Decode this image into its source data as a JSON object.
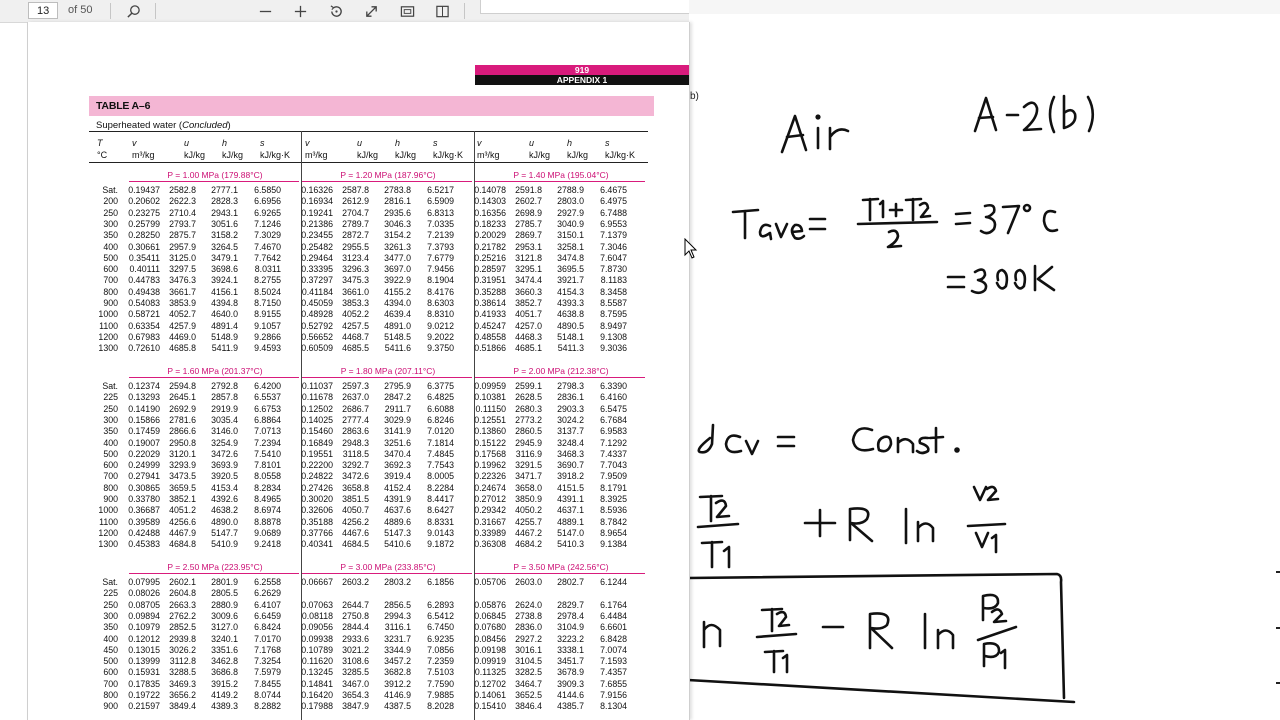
{
  "toolbar": {
    "page_current": "13",
    "page_total": "of 50",
    "icons": [
      "search-icon",
      "zoom-out-icon",
      "zoom-in-icon",
      "rotate-icon",
      "fit-width-icon",
      "fullscreen-icon",
      "two-page-icon"
    ]
  },
  "page": {
    "page_number": "919",
    "appendix": "APPENDIX 1",
    "table_title": "TABLE A–6",
    "subtitle_prefix": "Superheated water (",
    "subtitle_italic": "Concluded",
    "subtitle_suffix": ")",
    "col_T": "T",
    "col_T_unit": "°C",
    "group_headers": [
      {
        "v": "v",
        "u": "u",
        "h": "h",
        "s": "s",
        "v_unit": "m³/kg",
        "u_unit": "kJ/kg",
        "h_unit": "kJ/kg",
        "s_unit": "kJ/kg·K"
      },
      {
        "v": "v",
        "u": "u",
        "h": "h",
        "s": "s",
        "v_unit": "m³/kg",
        "u_unit": "kJ/kg",
        "h_unit": "kJ/kg",
        "s_unit": "kJ/kg·K"
      },
      {
        "v": "v",
        "u": "u",
        "h": "h",
        "s": "s",
        "v_unit": "m³/kg",
        "u_unit": "kJ/kg",
        "h_unit": "kJ/kg",
        "s_unit": "kJ/kg·K"
      }
    ],
    "sections": [
      {
        "pressures": [
          "P = 1.00 MPa (179.88°C)",
          "P = 1.20 MPa (187.96°C)",
          "P = 1.40 MPa (195.04°C)"
        ],
        "rows": [
          [
            "Sat.",
            "0.19437",
            "2582.8",
            "2777.1",
            "6.5850",
            "0.16326",
            "2587.8",
            "2783.8",
            "6.5217",
            "0.14078",
            "2591.8",
            "2788.9",
            "6.4675"
          ],
          [
            "200",
            "0.20602",
            "2622.3",
            "2828.3",
            "6.6956",
            "0.16934",
            "2612.9",
            "2816.1",
            "6.5909",
            "0.14303",
            "2602.7",
            "2803.0",
            "6.4975"
          ],
          [
            "250",
            "0.23275",
            "2710.4",
            "2943.1",
            "6.9265",
            "0.19241",
            "2704.7",
            "2935.6",
            "6.8313",
            "0.16356",
            "2698.9",
            "2927.9",
            "6.7488"
          ],
          [
            "300",
            "0.25799",
            "2793.7",
            "3051.6",
            "7.1246",
            "0.21386",
            "2789.7",
            "3046.3",
            "7.0335",
            "0.18233",
            "2785.7",
            "3040.9",
            "6.9553"
          ],
          [
            "350",
            "0.28250",
            "2875.7",
            "3158.2",
            "7.3029",
            "0.23455",
            "2872.7",
            "3154.2",
            "7.2139",
            "0.20029",
            "2869.7",
            "3150.1",
            "7.1379"
          ],
          [
            "400",
            "0.30661",
            "2957.9",
            "3264.5",
            "7.4670",
            "0.25482",
            "2955.5",
            "3261.3",
            "7.3793",
            "0.21782",
            "2953.1",
            "3258.1",
            "7.3046"
          ],
          [
            "500",
            "0.35411",
            "3125.0",
            "3479.1",
            "7.7642",
            "0.29464",
            "3123.4",
            "3477.0",
            "7.6779",
            "0.25216",
            "3121.8",
            "3474.8",
            "7.6047"
          ],
          [
            "600",
            "0.40111",
            "3297.5",
            "3698.6",
            "8.0311",
            "0.33395",
            "3296.3",
            "3697.0",
            "7.9456",
            "0.28597",
            "3295.1",
            "3695.5",
            "7.8730"
          ],
          [
            "700",
            "0.44783",
            "3476.3",
            "3924.1",
            "8.2755",
            "0.37297",
            "3475.3",
            "3922.9",
            "8.1904",
            "0.31951",
            "3474.4",
            "3921.7",
            "8.1183"
          ],
          [
            "800",
            "0.49438",
            "3661.7",
            "4156.1",
            "8.5024",
            "0.41184",
            "3661.0",
            "4155.2",
            "8.4176",
            "0.35288",
            "3660.3",
            "4154.3",
            "8.3458"
          ],
          [
            "900",
            "0.54083",
            "3853.9",
            "4394.8",
            "8.7150",
            "0.45059",
            "3853.3",
            "4394.0",
            "8.6303",
            "0.38614",
            "3852.7",
            "4393.3",
            "8.5587"
          ],
          [
            "1000",
            "0.58721",
            "4052.7",
            "4640.0",
            "8.9155",
            "0.48928",
            "4052.2",
            "4639.4",
            "8.8310",
            "0.41933",
            "4051.7",
            "4638.8",
            "8.7595"
          ],
          [
            "1100",
            "0.63354",
            "4257.9",
            "4891.4",
            "9.1057",
            "0.52792",
            "4257.5",
            "4891.0",
            "9.0212",
            "0.45247",
            "4257.0",
            "4890.5",
            "8.9497"
          ],
          [
            "1200",
            "0.67983",
            "4469.0",
            "5148.9",
            "9.2866",
            "0.56652",
            "4468.7",
            "5148.5",
            "9.2022",
            "0.48558",
            "4468.3",
            "5148.1",
            "9.1308"
          ],
          [
            "1300",
            "0.72610",
            "4685.8",
            "5411.9",
            "9.4593",
            "0.60509",
            "4685.5",
            "5411.6",
            "9.3750",
            "0.51866",
            "4685.1",
            "5411.3",
            "9.3036"
          ]
        ]
      },
      {
        "pressures": [
          "P = 1.60 MPa (201.37°C)",
          "P = 1.80 MPa (207.11°C)",
          "P = 2.00 MPa (212.38°C)"
        ],
        "rows": [
          [
            "Sat.",
            "0.12374",
            "2594.8",
            "2792.8",
            "6.4200",
            "0.11037",
            "2597.3",
            "2795.9",
            "6.3775",
            "0.09959",
            "2599.1",
            "2798.3",
            "6.3390"
          ],
          [
            "225",
            "0.13293",
            "2645.1",
            "2857.8",
            "6.5537",
            "0.11678",
            "2637.0",
            "2847.2",
            "6.4825",
            "0.10381",
            "2628.5",
            "2836.1",
            "6.4160"
          ],
          [
            "250",
            "0.14190",
            "2692.9",
            "2919.9",
            "6.6753",
            "0.12502",
            "2686.7",
            "2911.7",
            "6.6088",
            "0.11150",
            "2680.3",
            "2903.3",
            "6.5475"
          ],
          [
            "300",
            "0.15866",
            "2781.6",
            "3035.4",
            "6.8864",
            "0.14025",
            "2777.4",
            "3029.9",
            "6.8246",
            "0.12551",
            "2773.2",
            "3024.2",
            "6.7684"
          ],
          [
            "350",
            "0.17459",
            "2866.6",
            "3146.0",
            "7.0713",
            "0.15460",
            "2863.6",
            "3141.9",
            "7.0120",
            "0.13860",
            "2860.5",
            "3137.7",
            "6.9583"
          ],
          [
            "400",
            "0.19007",
            "2950.8",
            "3254.9",
            "7.2394",
            "0.16849",
            "2948.3",
            "3251.6",
            "7.1814",
            "0.15122",
            "2945.9",
            "3248.4",
            "7.1292"
          ],
          [
            "500",
            "0.22029",
            "3120.1",
            "3472.6",
            "7.5410",
            "0.19551",
            "3118.5",
            "3470.4",
            "7.4845",
            "0.17568",
            "3116.9",
            "3468.3",
            "7.4337"
          ],
          [
            "600",
            "0.24999",
            "3293.9",
            "3693.9",
            "7.8101",
            "0.22200",
            "3292.7",
            "3692.3",
            "7.7543",
            "0.19962",
            "3291.5",
            "3690.7",
            "7.7043"
          ],
          [
            "700",
            "0.27941",
            "3473.5",
            "3920.5",
            "8.0558",
            "0.24822",
            "3472.6",
            "3919.4",
            "8.0005",
            "0.22326",
            "3471.7",
            "3918.2",
            "7.9509"
          ],
          [
            "800",
            "0.30865",
            "3659.5",
            "4153.4",
            "8.2834",
            "0.27426",
            "3658.8",
            "4152.4",
            "8.2284",
            "0.24674",
            "3658.0",
            "4151.5",
            "8.1791"
          ],
          [
            "900",
            "0.33780",
            "3852.1",
            "4392.6",
            "8.4965",
            "0.30020",
            "3851.5",
            "4391.9",
            "8.4417",
            "0.27012",
            "3850.9",
            "4391.1",
            "8.3925"
          ],
          [
            "1000",
            "0.36687",
            "4051.2",
            "4638.2",
            "8.6974",
            "0.32606",
            "4050.7",
            "4637.6",
            "8.6427",
            "0.29342",
            "4050.2",
            "4637.1",
            "8.5936"
          ],
          [
            "1100",
            "0.39589",
            "4256.6",
            "4890.0",
            "8.8878",
            "0.35188",
            "4256.2",
            "4889.6",
            "8.8331",
            "0.31667",
            "4255.7",
            "4889.1",
            "8.7842"
          ],
          [
            "1200",
            "0.42488",
            "4467.9",
            "5147.7",
            "9.0689",
            "0.37766",
            "4467.6",
            "5147.3",
            "9.0143",
            "0.33989",
            "4467.2",
            "5147.0",
            "8.9654"
          ],
          [
            "1300",
            "0.45383",
            "4684.8",
            "5410.9",
            "9.2418",
            "0.40341",
            "4684.5",
            "5410.6",
            "9.1872",
            "0.36308",
            "4684.2",
            "5410.3",
            "9.1384"
          ]
        ]
      },
      {
        "pressures": [
          "P = 2.50 MPa (223.95°C)",
          "P = 3.00 MPa (233.85°C)",
          "P = 3.50 MPa (242.56°C)"
        ],
        "rows": [
          [
            "Sat.",
            "0.07995",
            "2602.1",
            "2801.9",
            "6.2558",
            "0.06667",
            "2603.2",
            "2803.2",
            "6.1856",
            "0.05706",
            "2603.0",
            "2802.7",
            "6.1244"
          ],
          [
            "225",
            "0.08026",
            "2604.8",
            "2805.5",
            "6.2629",
            "",
            "",
            "",
            "",
            "",
            "",
            "",
            ""
          ],
          [
            "250",
            "0.08705",
            "2663.3",
            "2880.9",
            "6.4107",
            "0.07063",
            "2644.7",
            "2856.5",
            "6.2893",
            "0.05876",
            "2624.0",
            "2829.7",
            "6.1764"
          ],
          [
            "300",
            "0.09894",
            "2762.2",
            "3009.6",
            "6.6459",
            "0.08118",
            "2750.8",
            "2994.3",
            "6.5412",
            "0.06845",
            "2738.8",
            "2978.4",
            "6.4484"
          ],
          [
            "350",
            "0.10979",
            "2852.5",
            "3127.0",
            "6.8424",
            "0.09056",
            "2844.4",
            "3116.1",
            "6.7450",
            "0.07680",
            "2836.0",
            "3104.9",
            "6.6601"
          ],
          [
            "400",
            "0.12012",
            "2939.8",
            "3240.1",
            "7.0170",
            "0.09938",
            "2933.6",
            "3231.7",
            "6.9235",
            "0.08456",
            "2927.2",
            "3223.2",
            "6.8428"
          ],
          [
            "450",
            "0.13015",
            "3026.2",
            "3351.6",
            "7.1768",
            "0.10789",
            "3021.2",
            "3344.9",
            "7.0856",
            "0.09198",
            "3016.1",
            "3338.1",
            "7.0074"
          ],
          [
            "500",
            "0.13999",
            "3112.8",
            "3462.8",
            "7.3254",
            "0.11620",
            "3108.6",
            "3457.2",
            "7.2359",
            "0.09919",
            "3104.5",
            "3451.7",
            "7.1593"
          ],
          [
            "600",
            "0.15931",
            "3288.5",
            "3686.8",
            "7.5979",
            "0.13245",
            "3285.5",
            "3682.8",
            "7.5103",
            "0.11325",
            "3282.5",
            "3678.9",
            "7.4357"
          ],
          [
            "700",
            "0.17835",
            "3469.3",
            "3915.2",
            "7.8455",
            "0.14841",
            "3467.0",
            "3912.2",
            "7.7590",
            "0.12702",
            "3464.7",
            "3909.3",
            "7.6855"
          ],
          [
            "800",
            "0.19722",
            "3656.2",
            "4149.2",
            "8.0744",
            "0.16420",
            "3654.3",
            "4146.9",
            "7.9885",
            "0.14061",
            "3652.5",
            "4144.6",
            "7.9156"
          ],
          [
            "900",
            "0.21597",
            "3849.4",
            "4389.3",
            "8.2882",
            "0.17988",
            "3847.9",
            "4387.5",
            "8.2028",
            "0.15410",
            "3846.4",
            "4385.7",
            "8.1304"
          ]
        ]
      }
    ]
  },
  "whiteboard": {
    "small_label": "b)"
  }
}
